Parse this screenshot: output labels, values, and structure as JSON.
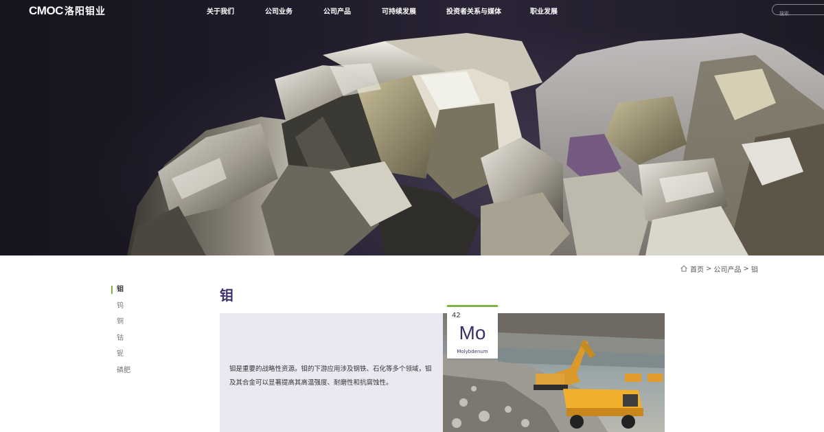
{
  "header": {
    "logo_mark": "CMOC",
    "logo_cn": "洛阳钼业",
    "nav": [
      {
        "label": "关于我们"
      },
      {
        "label": "公司业务"
      },
      {
        "label": "公司产品"
      },
      {
        "label": "可持续发展"
      },
      {
        "label": "投资者关系与媒体"
      },
      {
        "label": "职业发展"
      }
    ],
    "search_placeholder": "搜索..."
  },
  "breadcrumb": {
    "icon": "home-icon",
    "home": "首页",
    "sep": ">",
    "level1": "公司产品",
    "level2": "钼"
  },
  "subnav": {
    "items": [
      {
        "label": "钼",
        "active": true
      },
      {
        "label": "钨",
        "active": false
      },
      {
        "label": "铜",
        "active": false
      },
      {
        "label": "钴",
        "active": false
      },
      {
        "label": "铌",
        "active": false
      },
      {
        "label": "磷肥",
        "active": false
      }
    ]
  },
  "main": {
    "title": "钼",
    "description": "钼是重要的战略性资源。钼的下游应用涉及钢铁、石化等多个领域，钼及其合金可以显著提高其高温强度、耐磨性和抗腐蚀性。"
  },
  "element": {
    "number": "42",
    "symbol": "Mo",
    "name": "Molybdenum"
  },
  "colors": {
    "accent_green": "#7cb342",
    "brand_purple": "#3d2f6b",
    "panel_lavender": "#eae8f1"
  }
}
